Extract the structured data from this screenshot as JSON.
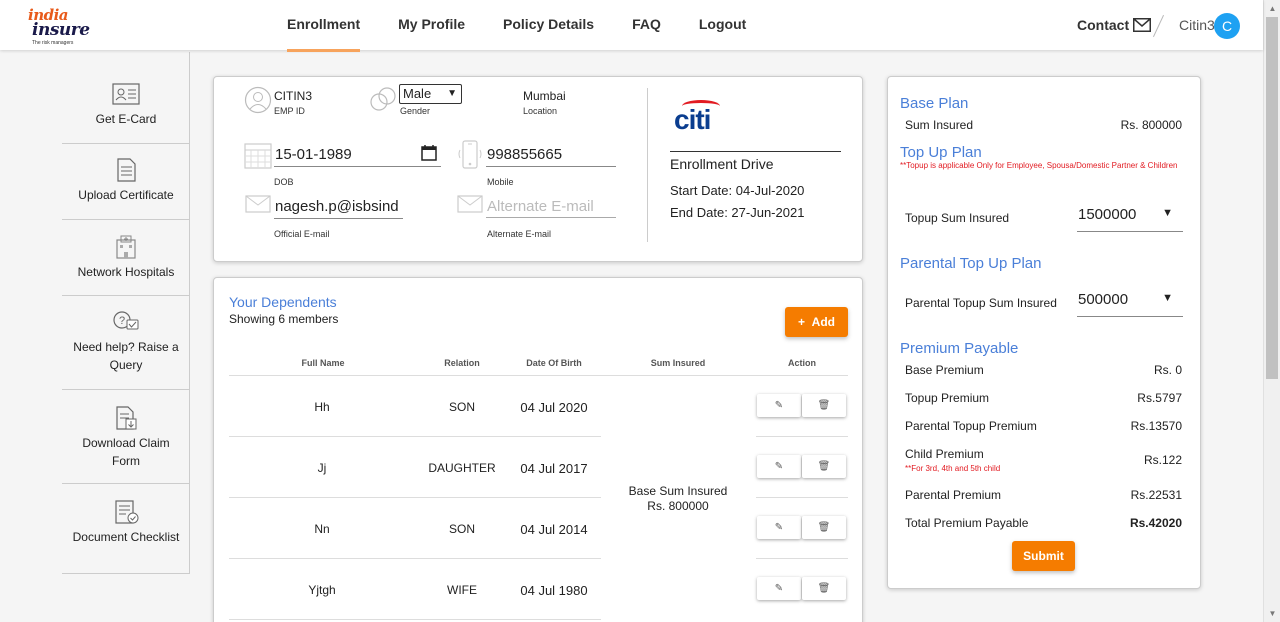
{
  "logo": {
    "line1": "india",
    "line2": "insure",
    "tagline": "The risk managers"
  },
  "nav": {
    "items": [
      {
        "label": "Enrollment"
      },
      {
        "label": "My Profile"
      },
      {
        "label": "Policy Details"
      },
      {
        "label": "FAQ"
      },
      {
        "label": "Logout"
      }
    ],
    "active": "Enrollment"
  },
  "header": {
    "contact": "Contact",
    "user": "Citin3",
    "avatar_letter": "C",
    "contact_icon": "mail-icon"
  },
  "sidebar": {
    "items": [
      {
        "label": "Get E-Card",
        "icon": "id-card-icon"
      },
      {
        "label": "Upload Certificate",
        "icon": "document-icon"
      },
      {
        "label": "Network Hospitals",
        "icon": "hospital-icon"
      },
      {
        "label": "Need help? Raise a Query",
        "icon": "help-chat-icon"
      },
      {
        "label": "Download Claim Form",
        "icon": "download-doc-icon"
      },
      {
        "label": "Document Checklist",
        "icon": "checklist-icon"
      }
    ]
  },
  "profile": {
    "emp_id": "CITIN3",
    "emp_id_label": "EMP ID",
    "gender": "Male",
    "gender_label": "Gender",
    "location": "Mumbai",
    "location_label": "Location",
    "dob": "15-01-1989",
    "dob_label": "DOB",
    "mobile": "998855665",
    "mobile_label": "Mobile",
    "email": "nagesh.p@isbsind",
    "email_label": "Official E-mail",
    "alt_email_placeholder": "Alternate E-mail",
    "alt_email_label": "Alternate E-mail"
  },
  "company": {
    "logo_text": "citi",
    "drive_title": "Enrollment Drive",
    "start_date": "Start Date: 04-Jul-2020",
    "end_date": "End Date: 27-Jun-2021"
  },
  "dependents": {
    "title": "Your Dependents",
    "subtitle": "Showing 6 members",
    "add_label": "Add",
    "columns": [
      "Full Name",
      "Relation",
      "Date Of Birth",
      "Sum Insured",
      "Action"
    ],
    "rows": [
      {
        "name": "Hh",
        "relation": "SON",
        "dob": "04 Jul 2020"
      },
      {
        "name": "Jj",
        "relation": "DAUGHTER",
        "dob": "04 Jul 2017"
      },
      {
        "name": "Nn",
        "relation": "SON",
        "dob": "04 Jul 2014"
      },
      {
        "name": "Yjtgh",
        "relation": "WIFE",
        "dob": "04 Jul 1980"
      }
    ],
    "sum_insured_line1": "Base Sum Insured",
    "sum_insured_line2": "Rs. 800000"
  },
  "plan": {
    "base_title": "Base Plan",
    "sum_insured_label": "Sum Insured",
    "sum_insured_value": "Rs. 800000",
    "topup_title": "Top Up Plan",
    "topup_note": "**Topup is applicable Only for Employee, Spousa/Domestic Partner & Children",
    "topup_label": "Topup Sum Insured",
    "topup_value": "1500000",
    "parental_title": "Parental Top Up Plan",
    "parental_label": "Parental Topup Sum Insured",
    "parental_value": "500000",
    "premium_title": "Premium Payable",
    "premiums": [
      {
        "label": "Base Premium",
        "value": "Rs. 0"
      },
      {
        "label": "Topup Premium",
        "value": "Rs.5797"
      },
      {
        "label": "Parental Topup Premium",
        "value": "Rs.13570"
      },
      {
        "label": "Child Premium",
        "value": "Rs.122"
      },
      {
        "label": "Parental Premium",
        "value": "Rs.22531"
      },
      {
        "label": "Total Premium Payable",
        "value": "Rs.42020"
      }
    ],
    "child_note": "**For 3rd, 4th and 5th child",
    "submit_label": "Submit"
  },
  "colors": {
    "accent": "#f57c00",
    "heading": "#4a7fd8",
    "citi_blue": "#0a3d8f",
    "citi_red": "#e21b22",
    "note_red": "#e21b22",
    "avatar": "#1ea1f2"
  }
}
